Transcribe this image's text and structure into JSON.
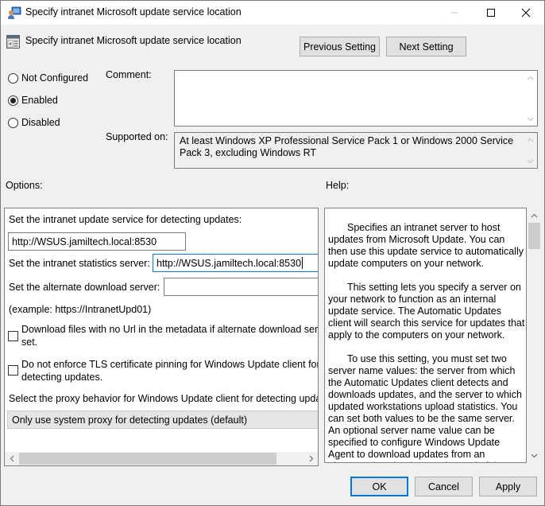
{
  "window": {
    "title": "Specify intranet Microsoft update service location",
    "controls": {
      "minimize": "minimize",
      "maximize": "maximize",
      "close": "close"
    }
  },
  "header": {
    "policy_title": "Specify intranet Microsoft update service location",
    "previous_button": "Previous Setting",
    "next_button": "Next Setting"
  },
  "state": {
    "options": [
      {
        "label": "Not Configured",
        "selected": false
      },
      {
        "label": "Enabled",
        "selected": true
      },
      {
        "label": "Disabled",
        "selected": false
      }
    ]
  },
  "comment": {
    "label": "Comment:",
    "value": ""
  },
  "supported": {
    "label": "Supported on:",
    "value": "At least Windows XP Professional Service Pack 1 or Windows 2000 Service Pack 3, excluding Windows RT"
  },
  "options_panel": {
    "heading": "Options:",
    "update_service_label": "Set the intranet update service for detecting updates:",
    "update_service_value": "http://WSUS.jamiltech.local:8530",
    "statistics_label": "Set the intranet statistics server:",
    "statistics_value": "http://WSUS.jamiltech.local:8530",
    "alternate_label": "Set the alternate download server:",
    "alternate_value": "",
    "example_text": "(example: https://IntranetUpd01)",
    "checkbox_download": {
      "label_line1": "Download files with no Url in the metadata if alternate download server is",
      "label_line2": "set.",
      "checked": false
    },
    "checkbox_tls": {
      "label_line1": "Do not enforce TLS certificate pinning for Windows Update client for",
      "label_line2": "detecting updates.",
      "checked": false
    },
    "proxy_label": "Select the proxy behavior for Windows Update client for detecting updates:",
    "proxy_value": "Only use system proxy for detecting updates (default)"
  },
  "help_panel": {
    "heading": "Help:",
    "paragraphs": [
      "Specifies an intranet server to host updates from Microsoft Update. You can then use this update service to automatically update computers on your network.",
      "This setting lets you specify a server on your network to function as an internal update service. The Automatic Updates client will search this service for updates that apply to the computers on your network.",
      "To use this setting, you must set two server name values: the server from which the Automatic Updates client detects and downloads updates, and the server to which updated workstations upload statistics. You can set both values to be the same server. An optional server name value can be specified to configure Windows Update Agent to download updates from an alternate download server instead of the intranet update service."
    ]
  },
  "footer": {
    "ok": "OK",
    "cancel": "Cancel",
    "apply": "Apply"
  },
  "colors": {
    "accent": "#0078d7",
    "background": "#f0f0f0"
  }
}
